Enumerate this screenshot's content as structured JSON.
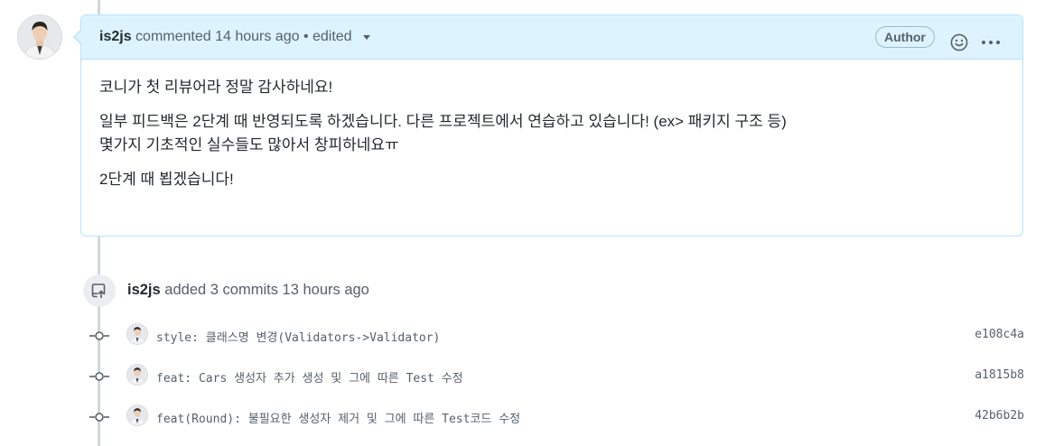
{
  "comment": {
    "author": "is2js",
    "meta": "commented 14 hours ago • edited",
    "badge": "Author",
    "paragraphs": [
      [
        "코니가 첫 리뷰어라 정말 감사하네요!"
      ],
      [
        "일부 피드백은 2단계 때 반영되도록 하겠습니다. 다른 프로젝트에서 연습하고 있습니다! (ex> 패키지 구조 등)",
        "몇가지 기초적인 실수들도 많아서 창피하네요ㅠ"
      ],
      [
        "2단계 때 뵙겠습니다!"
      ]
    ]
  },
  "event": {
    "actor": "is2js",
    "text": "added 3 commits 13 hours ago"
  },
  "commits": [
    {
      "message": "style: 클래스명 변경(Validators->Validator)",
      "sha": "e108c4a"
    },
    {
      "message": "feat: Cars 생성자 추가 생성 및 그에 따른 Test 수정",
      "sha": "a1815b8"
    },
    {
      "message": "feat(Round): 불필요한 생성자 제거 및 그에 따른 Test코드 수정",
      "sha": "42b6b2b"
    }
  ],
  "icons": {
    "emoji": "smiley-icon",
    "more": "kebab-horizontal-icon",
    "event": "repo-push-icon",
    "commit": "git-commit-icon"
  }
}
